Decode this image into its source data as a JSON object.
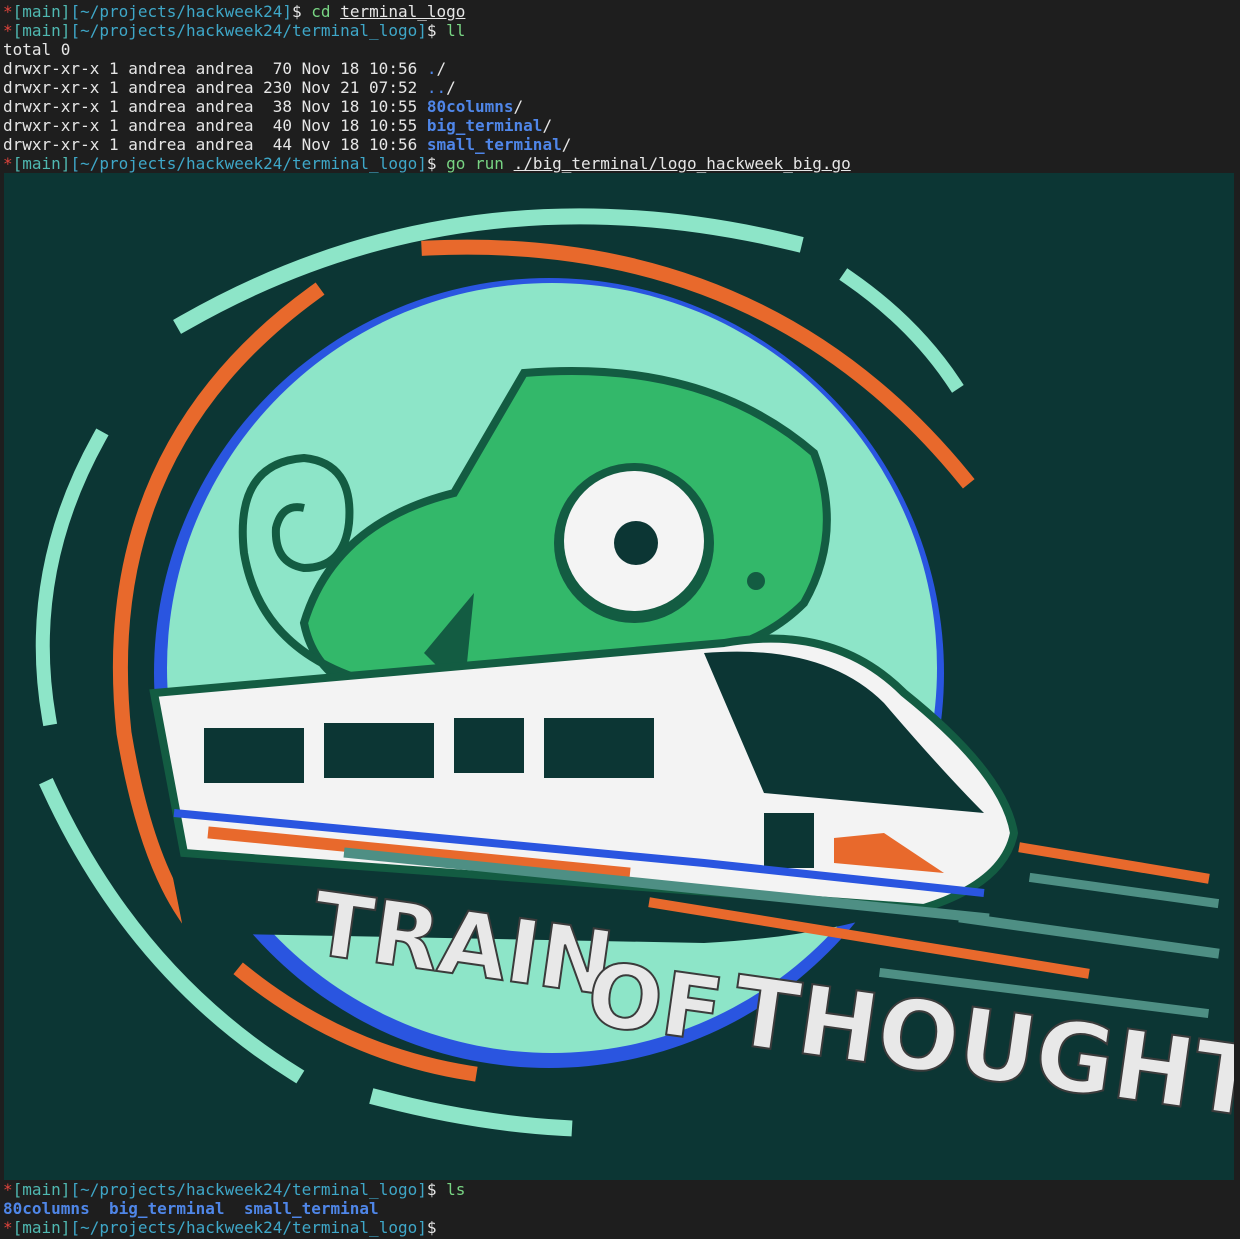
{
  "colors": {
    "background": "#1e1e1e",
    "prompt_marker": "#e0443c",
    "prompt_path": "#3ea7c8",
    "directory": "#4f86e8",
    "logo_background": "#0c3634",
    "logo_mint": "#8de5c8",
    "logo_green": "#33b86a",
    "logo_orange": "#e8692c",
    "logo_blue": "#2a55e0"
  },
  "prompt": {
    "marker": "*",
    "branch": "[main]",
    "sep": "$"
  },
  "lines": [
    {
      "path": "[~/projects/hackweek24]",
      "cmd": "cd",
      "arg": "terminal_logo"
    },
    {
      "path": "[~/projects/hackweek24/terminal_logo]",
      "cmd": "ll",
      "arg": ""
    }
  ],
  "listing": {
    "total": "total 0",
    "rows": [
      {
        "meta": "drwxr-xr-x 1 andrea andrea  70 Nov 18 10:56 ",
        "name": ".",
        "suffix": "/"
      },
      {
        "meta": "drwxr-xr-x 1 andrea andrea 230 Nov 21 07:52 ",
        "name": "..",
        "suffix": "/"
      },
      {
        "meta": "drwxr-xr-x 1 andrea andrea  38 Nov 18 10:55 ",
        "name": "80columns",
        "suffix": "/"
      },
      {
        "meta": "drwxr-xr-x 1 andrea andrea  40 Nov 18 10:55 ",
        "name": "big_terminal",
        "suffix": "/"
      },
      {
        "meta": "drwxr-xr-x 1 andrea andrea  44 Nov 18 10:56 ",
        "name": "small_terminal",
        "suffix": "/"
      }
    ]
  },
  "run": {
    "path": "[~/projects/hackweek24/terminal_logo]",
    "cmd": "go run",
    "arg": "./big_terminal/logo_hackweek_big.go"
  },
  "logo": {
    "text_line1": "TRAIN",
    "text_line2a": "OF",
    "text_line2b": "THOUGHT"
  },
  "after": {
    "path": "[~/projects/hackweek24/terminal_logo]",
    "cmd": "ls",
    "entries": [
      "80columns",
      "big_terminal",
      "small_terminal"
    ],
    "final_path": "[~/projects/hackweek24/terminal_logo]"
  }
}
